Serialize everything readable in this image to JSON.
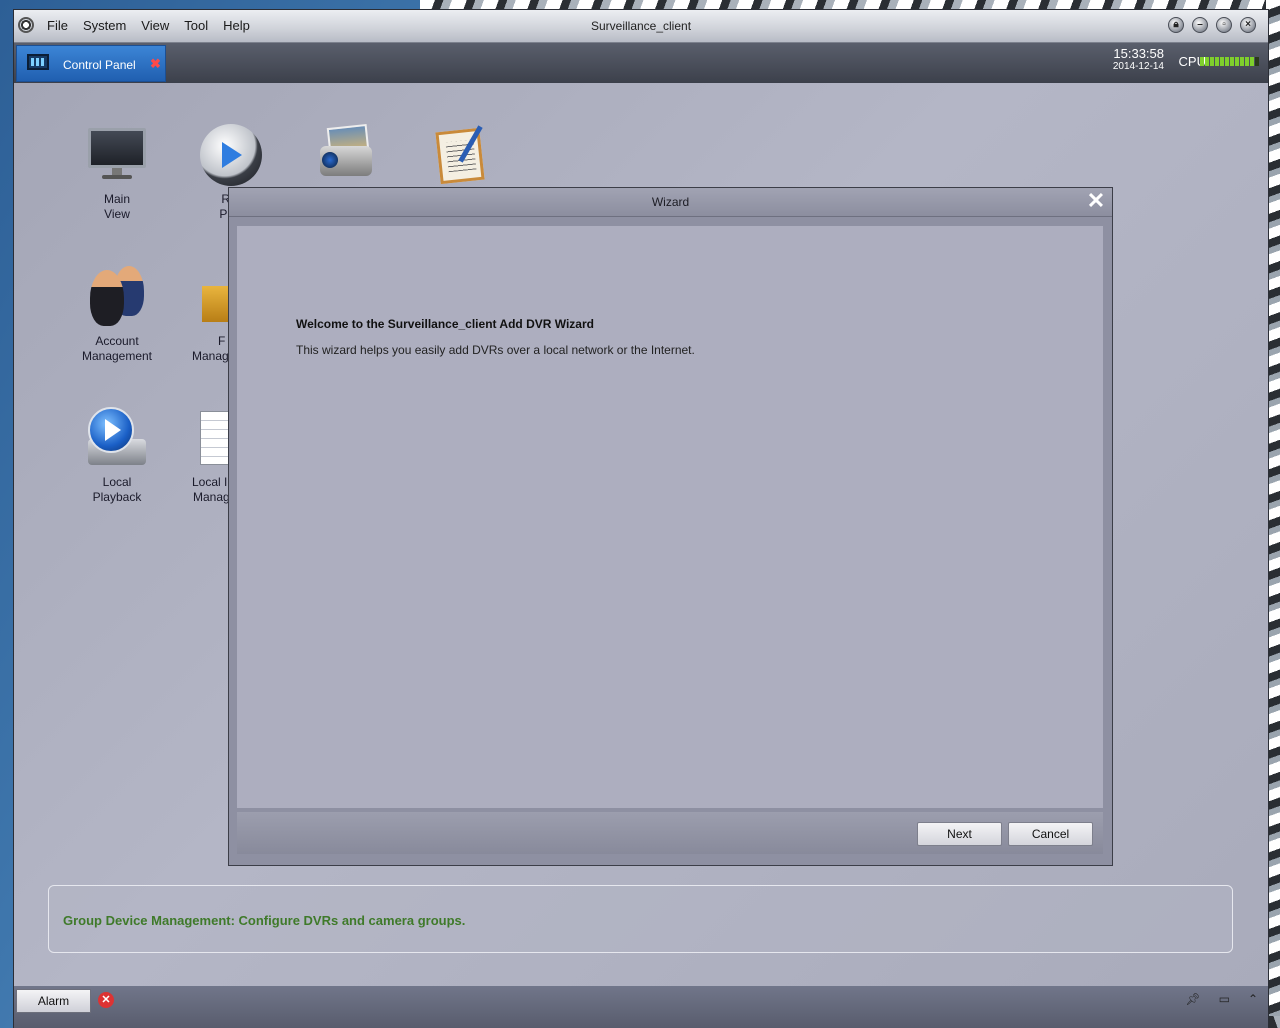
{
  "menu": {
    "items": [
      "File",
      "System",
      "View",
      "Tool",
      "Help"
    ]
  },
  "window": {
    "title": "Surveillance_client"
  },
  "tab": {
    "label": "Control Panel",
    "close": "✖"
  },
  "clock": {
    "time": "15:33:58",
    "date": "2014-12-14"
  },
  "cpu": {
    "label": "CPU",
    "level": 0.95,
    "color": "#7fcf2c"
  },
  "desktop": {
    "icons": [
      {
        "line1": "Main",
        "line2": "View",
        "icon": "monitor-icon"
      },
      {
        "line1": "Rer",
        "line2": "Play",
        "icon": "remote-playback-icon"
      },
      {
        "line1": "",
        "line2": "",
        "icon": "projector-icon"
      },
      {
        "line1": "",
        "line2": "",
        "icon": "notepad-icon"
      },
      {
        "line1": "Account",
        "line2": "Management",
        "icon": "users-icon"
      },
      {
        "line1": "F",
        "line2": "Manag",
        "icon": "folder-icon"
      },
      {
        "line1": "Local",
        "line2": "Playback",
        "icon": "play-disk-icon"
      },
      {
        "line1": "Local I",
        "line2": "Manag",
        "icon": "spreadsheet-icon"
      }
    ]
  },
  "wizard": {
    "title": "Wizard",
    "close": "✕",
    "heading": "Welcome to the Surveillance_client Add DVR Wizard",
    "text": "This wizard helps you easily add DVRs over a local network or the Internet.",
    "next_label": "Next",
    "cancel_label": "Cancel"
  },
  "status": {
    "text": "Group Device Management: Configure DVRs and camera groups."
  },
  "bottombar": {
    "alarm_label": "Alarm",
    "alarm_icon": "✕"
  },
  "colors": {
    "accent_tab": "#205fb0",
    "status_text": "#3f7a2a"
  }
}
